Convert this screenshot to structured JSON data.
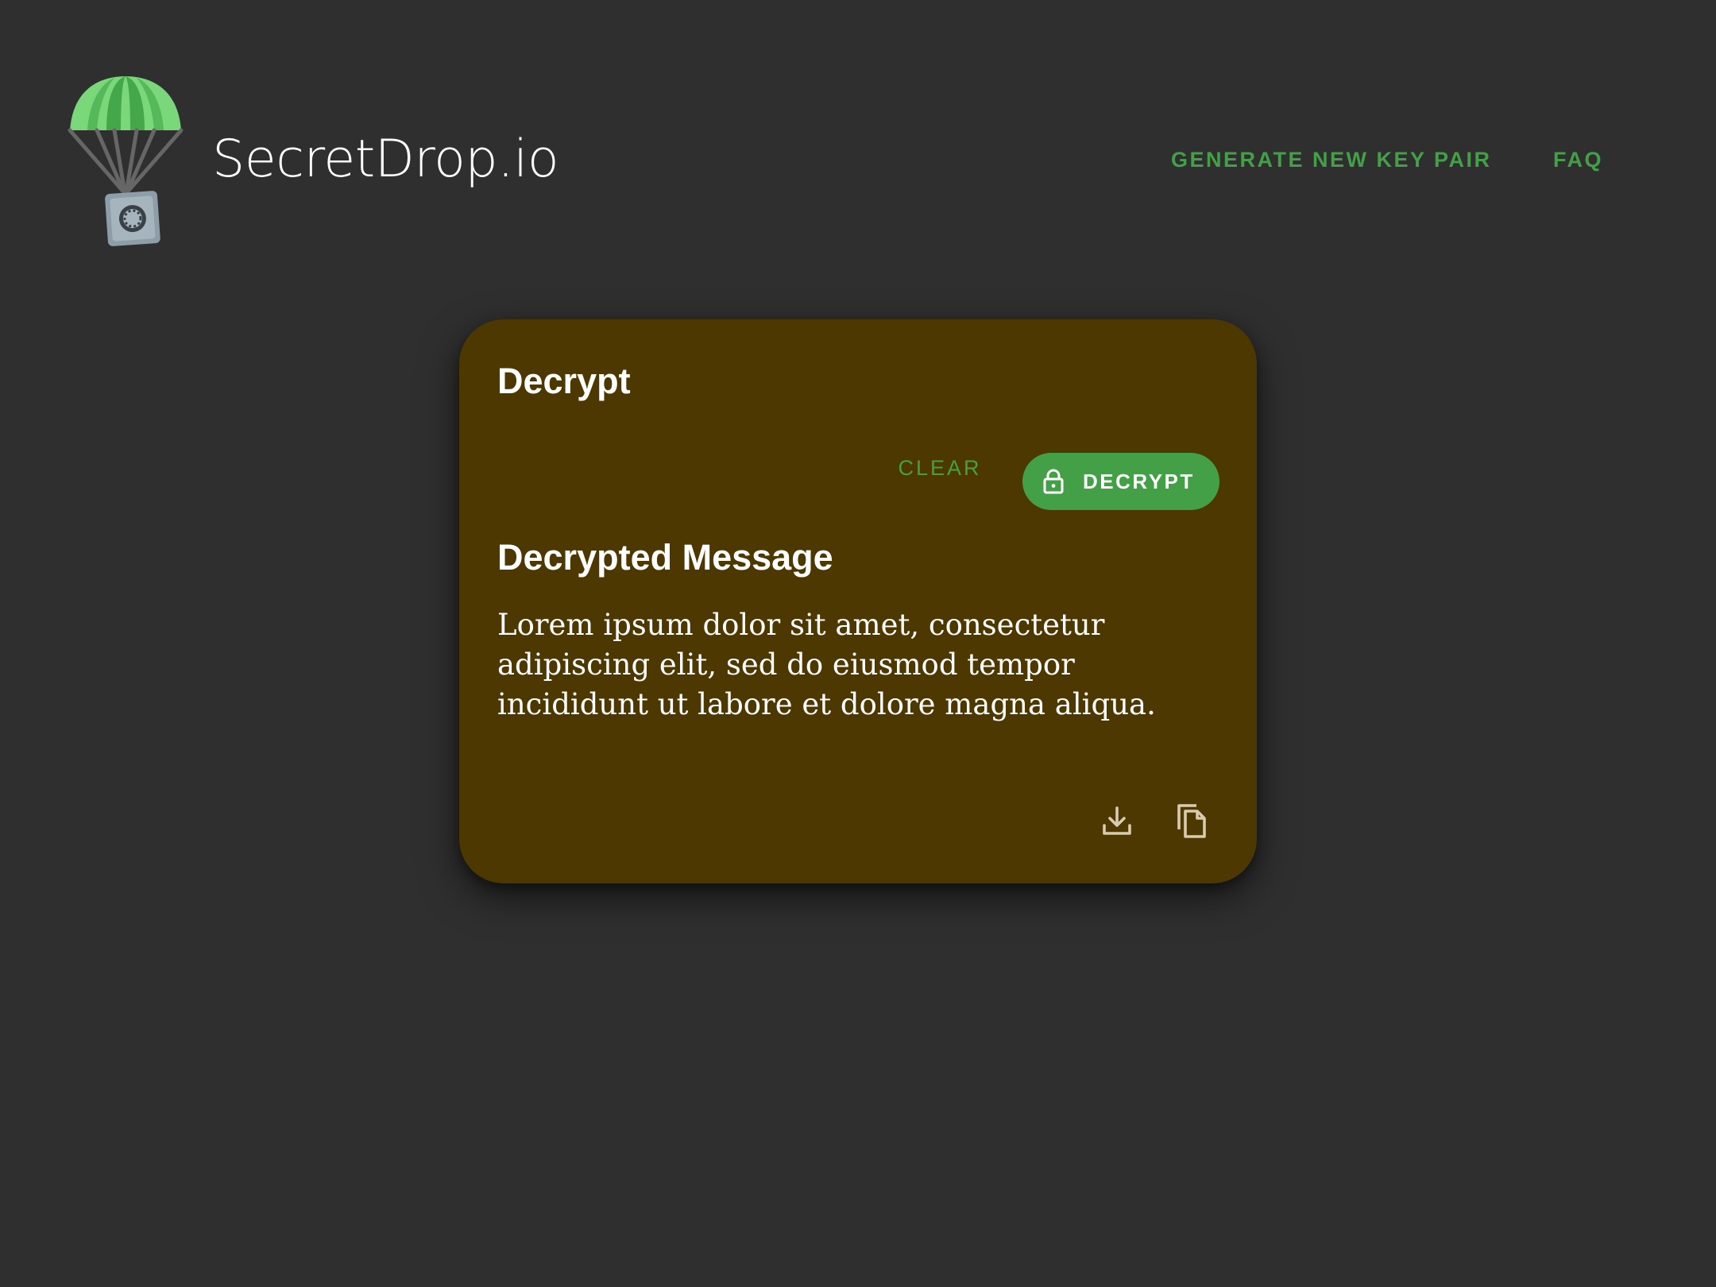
{
  "header": {
    "brand": "SecretDrop.io",
    "logo_icon": "parachute-safe-icon",
    "nav": [
      {
        "label": "GENERATE NEW KEY PAIR"
      },
      {
        "label": "FAQ"
      }
    ]
  },
  "card": {
    "title": "Decrypt",
    "clear_label": "CLEAR",
    "decrypt_label": "DECRYPT",
    "decrypt_icon": "lock-icon",
    "message_title": "Decrypted Message",
    "message_body": "Lorem ipsum dolor sit amet, consectetur adipiscing elit, sed do eiusmod tempor incididunt ut labore et dolore magna aliqua.",
    "actions": [
      {
        "icon": "download-icon"
      },
      {
        "icon": "copy-icon"
      }
    ]
  },
  "colors": {
    "background": "#2f2f2f",
    "card": "#4c3800",
    "accent": "#43a047",
    "text": "#ffffff",
    "icon": "#d8ccb0"
  }
}
